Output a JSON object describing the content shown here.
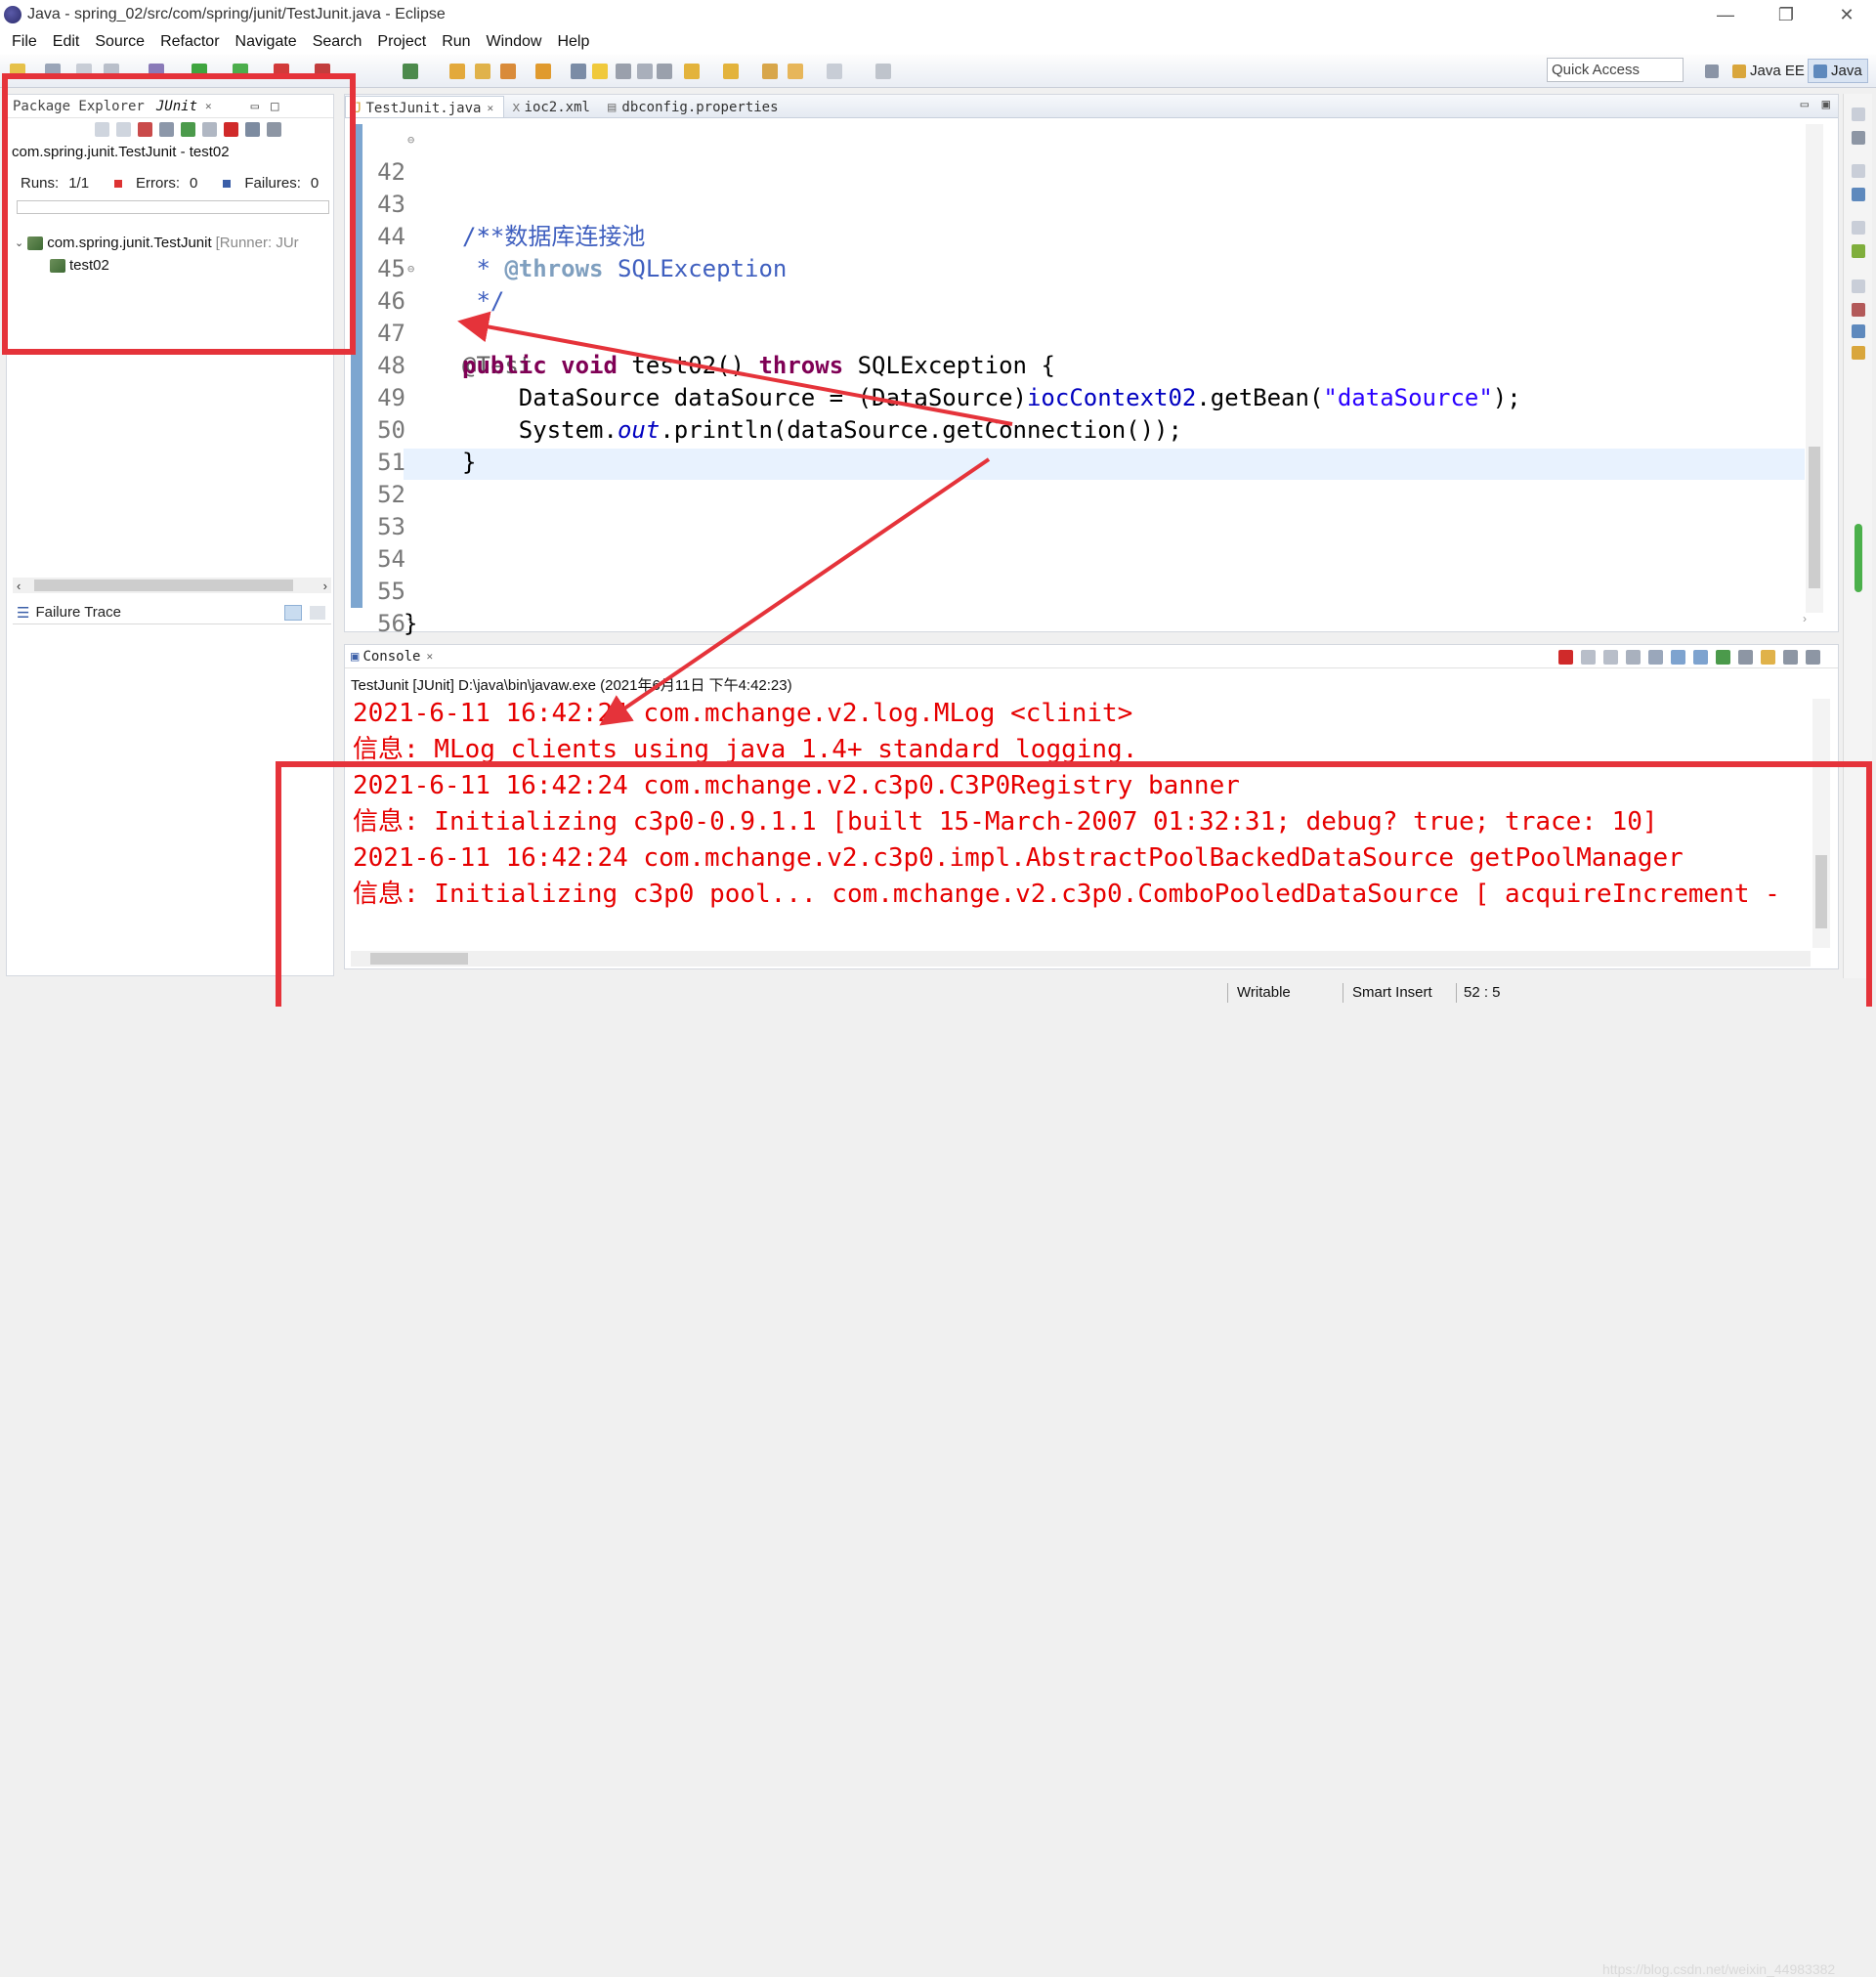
{
  "window": {
    "title": "Java - spring_02/src/com/spring/junit/TestJunit.java - Eclipse",
    "minimize": "—",
    "maximize": "❐",
    "close": "✕"
  },
  "menu": [
    "File",
    "Edit",
    "Source",
    "Refactor",
    "Navigate",
    "Search",
    "Project",
    "Run",
    "Window",
    "Help"
  ],
  "toolbar": {
    "quick_access_placeholder": "Quick Access",
    "perspectives": [
      "Java EE",
      "Java"
    ]
  },
  "left_panel": {
    "tabs": [
      "Package Explorer",
      "JUnit"
    ],
    "test_title": "com.spring.junit.TestJunit - test02",
    "runs_label": "Runs:",
    "runs_value": "1/1",
    "errors_label": "Errors:",
    "errors_value": "0",
    "failures_label": "Failures:",
    "failures_value": "0",
    "tree": {
      "root": "com.spring.junit.TestJunit",
      "runner": "[Runner: JUr",
      "child": "test02"
    },
    "failure_trace": "Failure Trace"
  },
  "editor": {
    "tabs": [
      "TestJunit.java",
      "ioc2.xml",
      "dbconfig.properties"
    ],
    "lines": [
      {
        "n": "42",
        "fold": "⊖"
      },
      {
        "n": "43"
      },
      {
        "n": "44"
      },
      {
        "n": "45"
      },
      {
        "n": "46",
        "fold": "⊖"
      },
      {
        "n": "47"
      },
      {
        "n": "48"
      },
      {
        "n": "49"
      },
      {
        "n": "50"
      },
      {
        "n": "51"
      },
      {
        "n": "52"
      },
      {
        "n": "53"
      },
      {
        "n": "54"
      },
      {
        "n": "55"
      },
      {
        "n": "56"
      }
    ],
    "code": {
      "l42": "/**",
      "l43_a": " * ",
      "l43_b": "数据库连接池",
      "l44_a": " * ",
      "l44_tag": "@throws",
      "l44_b": " SQLException",
      "l45": " */",
      "l46": "@Test",
      "l47_kw1": "public",
      "l47_kw2": "void",
      "l47_a": " test02() ",
      "l47_kw3": "throws",
      "l47_b": " SQLException {",
      "l48_a": "    DataSource dataSource = (DataSource)",
      "l48_fld": "iocContext02",
      "l48_b": ".getBean(",
      "l48_str": "\"dataSource\"",
      "l48_c": ");",
      "l49_a": "    System.",
      "l49_it": "out",
      "l49_b": ".println(dataSource.getConnection());",
      "l50": "}",
      "l55": "}"
    }
  },
  "console": {
    "tab": "Console",
    "description": "TestJunit [JUnit] D:\\java\\bin\\javaw.exe (2021年6月11日 下午4:42:23)",
    "lines": [
      "2021-6-11 16:42:24 com.mchange.v2.log.MLog <clinit>",
      "信息: MLog clients using java 1.4+ standard logging.",
      "2021-6-11 16:42:24 com.mchange.v2.c3p0.C3P0Registry banner",
      "信息: Initializing c3p0-0.9.1.1 [built 15-March-2007 01:32:31; debug? true; trace: 10]",
      "2021-6-11 16:42:24 com.mchange.v2.c3p0.impl.AbstractPoolBackedDataSource getPoolManager",
      "信息: Initializing c3p0 pool... com.mchange.v2.c3p0.ComboPooledDataSource [ acquireIncrement -"
    ]
  },
  "status": {
    "writable": "Writable",
    "insert_mode": "Smart Insert",
    "position": "52 : 5",
    "watermark": "https://blog.csdn.net/weixin_44983382"
  },
  "colors": {
    "annotation_red": "#e5333a",
    "console_text": "#e60000",
    "keyword": "#7f0055",
    "comment": "#3f5fbf"
  }
}
